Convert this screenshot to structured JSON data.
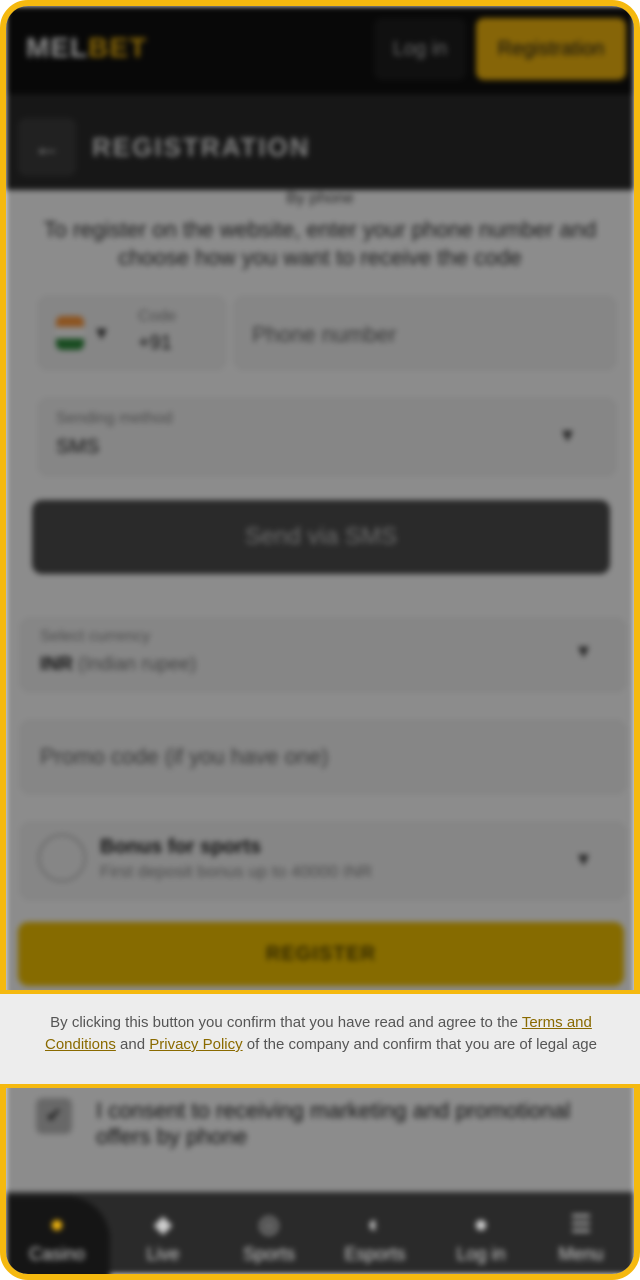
{
  "header": {
    "logo_part1": "MEL",
    "logo_part2": "BET",
    "login_label": "Log in",
    "register_label": "Registration"
  },
  "subheader": {
    "title": "REGISTRATION"
  },
  "form": {
    "section_title": "By phone",
    "intro": "To register on the website, enter your phone number and choose how you want to receive the code",
    "code_label": "Code",
    "code_value": "+91",
    "phone_placeholder": "Phone number",
    "sending_method_label": "Sending method",
    "sending_method_value": "SMS",
    "send_button": "Send via SMS",
    "currency_label": "Select currency",
    "currency_value": "INR",
    "currency_name": "(Indian rupee)",
    "promo_placeholder": "Promo code (if you have one)",
    "bonus_title": "Bonus for sports",
    "bonus_subtitle": "First deposit bonus up to 40000 INR",
    "register_button": "REGISTER",
    "consent_text": "I consent to receiving marketing and promotional offers by phone"
  },
  "notice": {
    "text_1": "By clicking this button you confirm that you have read and agree to the ",
    "link_terms": "Terms and Conditions",
    "text_2": " and ",
    "link_privacy": "Privacy Policy",
    "text_3": " of the company and confirm that you are of legal age"
  },
  "bottom_nav": {
    "items": [
      {
        "label": "Casino",
        "icon": "casino-icon"
      },
      {
        "label": "Live",
        "icon": "live-icon"
      },
      {
        "label": "Sports",
        "icon": "sports-icon"
      },
      {
        "label": "Esports",
        "icon": "esports-icon"
      },
      {
        "label": "Log in",
        "icon": "user-icon"
      },
      {
        "label": "Menu",
        "icon": "menu-icon"
      }
    ]
  },
  "colors": {
    "accent": "#f5b90f",
    "dark": "#101010"
  }
}
